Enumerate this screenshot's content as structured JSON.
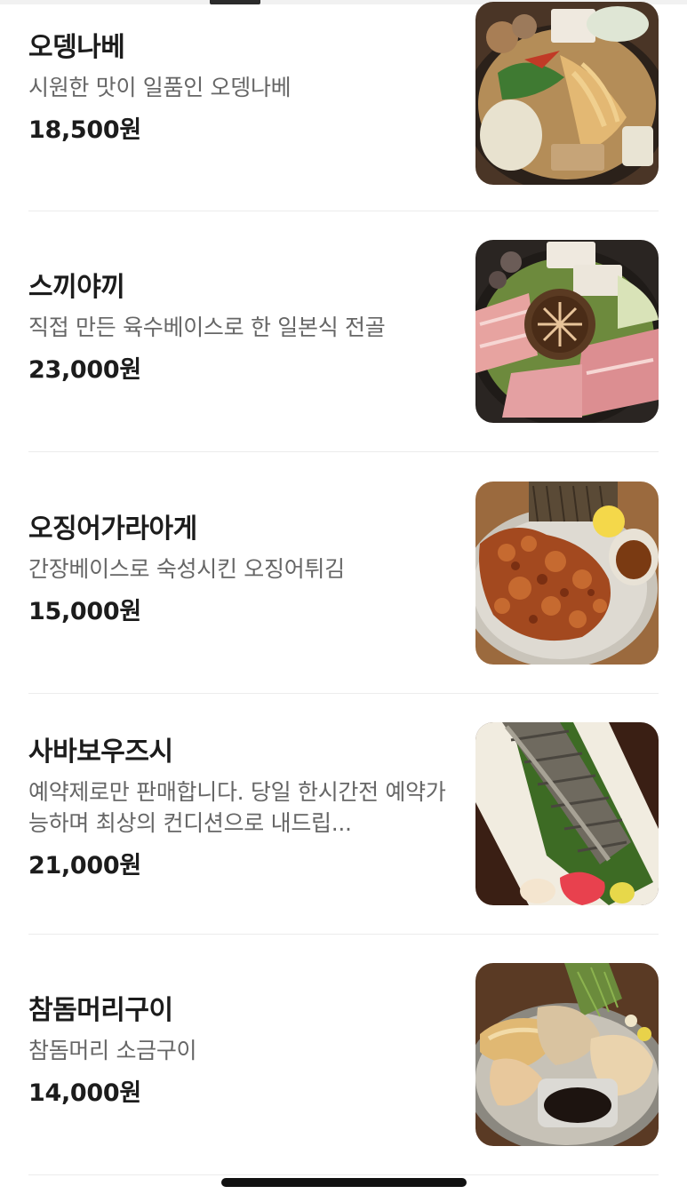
{
  "menu": {
    "items": [
      {
        "name": "오뎅나베",
        "description": "시원한 맛이 일품인 오뎅나베",
        "price": "18,500원",
        "photo": "oden-nabe-photo"
      },
      {
        "name": "스끼야끼",
        "description": "직접 만든 육수베이스로 한 일본식 전골",
        "price": "23,000원",
        "photo": "sukiyaki-photo"
      },
      {
        "name": "오징어가라아게",
        "description": "간장베이스로 숙성시킨 오징어튀김",
        "price": "15,000원",
        "photo": "squid-karaage-photo"
      },
      {
        "name": "사바보우즈시",
        "description": "예약제로만 판매합니다. 당일 한시간전 예약가능하며 최상의 컨디션으로 내드립...",
        "price": "21,000원",
        "photo": "saba-bou-zushi-photo"
      },
      {
        "name": "참돔머리구이",
        "description": "참돔머리 소금구이",
        "price": "14,000원",
        "photo": "sea-bream-head-photo"
      }
    ]
  },
  "colors": {
    "text_primary": "#1c1c1c",
    "text_secondary": "#666666",
    "divider": "#ececec",
    "background": "#ffffff"
  }
}
